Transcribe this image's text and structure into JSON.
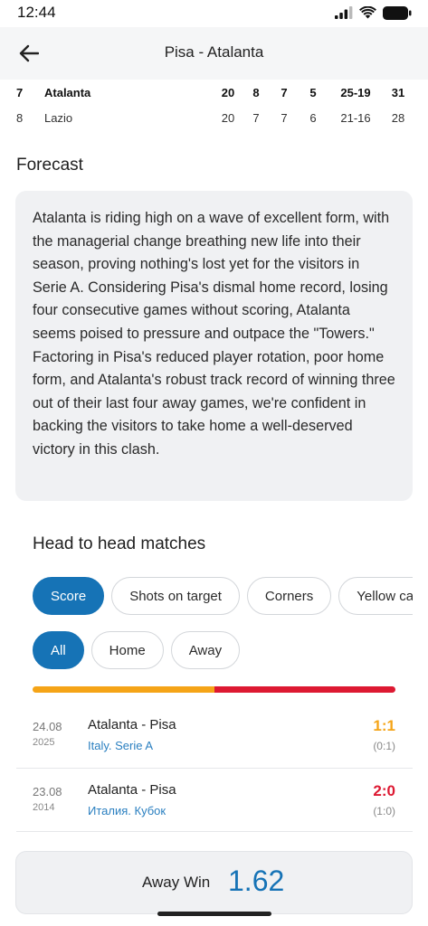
{
  "status_bar": {
    "time": "12:44"
  },
  "header": {
    "title": "Pisa - Atalanta",
    "back_icon": "arrow-left-icon"
  },
  "standings": [
    {
      "pos": "7",
      "team": "Atalanta",
      "g": "20",
      "w": "8",
      "d": "7",
      "l": "5",
      "goals": "25-19",
      "pts": "31",
      "highlight": true
    },
    {
      "pos": "8",
      "team": "Lazio",
      "g": "20",
      "w": "7",
      "d": "7",
      "l": "6",
      "goals": "21-16",
      "pts": "28",
      "highlight": false
    }
  ],
  "forecast": {
    "title": "Forecast",
    "text": "Atalanta is riding high on a wave of excellent form, with the managerial change breathing new life into their season, proving nothing's lost yet for the visitors in Serie A. Considering Pisa's dismal home record, losing four consecutive games without scoring, Atalanta seems poised to pressure and outpace the \"Towers.\" Factoring in Pisa's reduced player rotation, poor home form, and Atalanta's robust track record of winning three out of their last four away games, we're confident in backing the visitors to take home a well-deserved victory in this clash."
  },
  "h2h": {
    "title": "Head to head matches",
    "stat_tabs": [
      "Score",
      "Shots on target",
      "Corners",
      "Yellow cards"
    ],
    "filter_tabs": [
      "All",
      "Home",
      "Away"
    ],
    "ratio": {
      "first": 0.5,
      "second": 0.5,
      "first_color": "#f5a417",
      "second_color": "#dd1932"
    },
    "matches": [
      {
        "date": "24.08",
        "year": "2025",
        "teams": "Atalanta - Pisa",
        "league": "Italy. Serie A",
        "score": "1:1",
        "half": "(0:1)",
        "score_color": "#f5a417"
      },
      {
        "date": "23.08",
        "year": "2014",
        "teams": "Atalanta - Pisa",
        "league": "Италия. Кубок",
        "score": "2:0",
        "half": "(1:0)",
        "score_color": "#dd1932"
      }
    ]
  },
  "bet": {
    "label": "Away Win",
    "value": "1.62",
    "accent": "#1673b6"
  }
}
